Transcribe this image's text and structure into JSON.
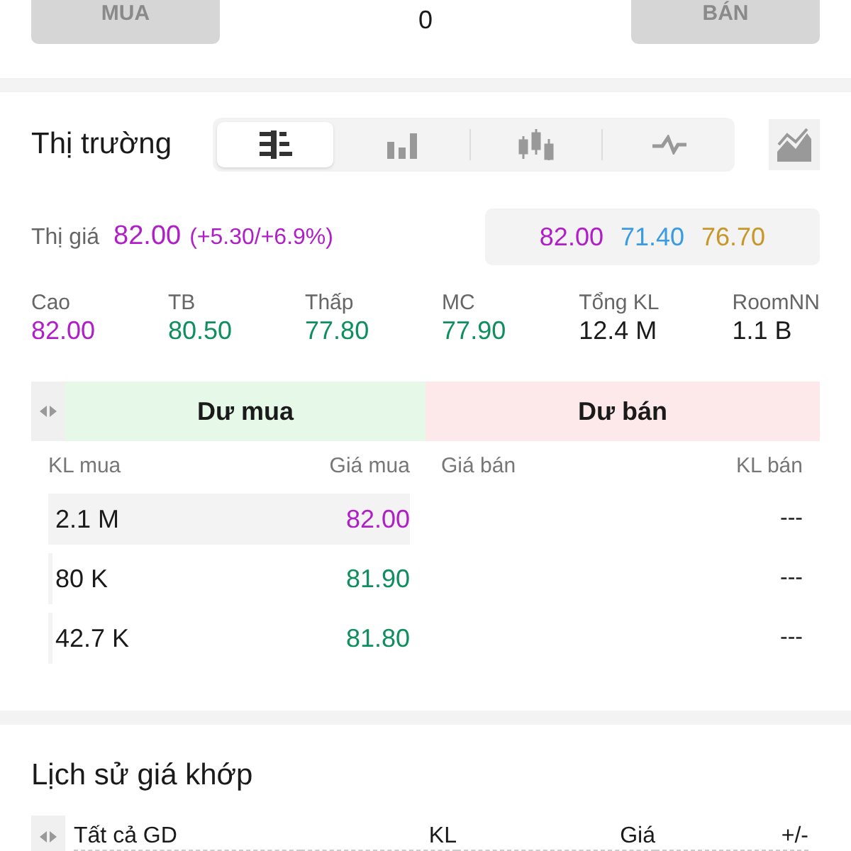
{
  "order_bar": {
    "buy_label": "MUA",
    "quantity": "0",
    "sell_label": "BÁN"
  },
  "market": {
    "title": "Thị trường",
    "view_tabs": [
      {
        "kind": "depth",
        "selected": true
      },
      {
        "kind": "bars",
        "selected": false
      },
      {
        "kind": "candles",
        "selected": false
      },
      {
        "kind": "line",
        "selected": false
      }
    ],
    "price_label": "Thị giá",
    "price": "82.00",
    "change": "(+5.30/+6.9%)",
    "ref_prices": [
      {
        "value": "82.00",
        "color": "#b01ec8"
      },
      {
        "value": "71.40",
        "color": "#3a9be2"
      },
      {
        "value": "76.70",
        "color": "#c8972a"
      }
    ],
    "stats": [
      {
        "label": "Cao",
        "value": "82.00",
        "color": "#b01ec8"
      },
      {
        "label": "TB",
        "value": "80.50",
        "color": "#0f8f60"
      },
      {
        "label": "Thấp",
        "value": "77.80",
        "color": "#0f8f60"
      },
      {
        "label": "MC",
        "value": "77.90",
        "color": "#0f8f60"
      },
      {
        "label": "Tổng KL",
        "value": "12.4 M",
        "color": "#1a1a1a"
      },
      {
        "label": "RoomNN",
        "value": "1.1 B",
        "color": "#1a1a1a"
      }
    ],
    "book": {
      "buy_header": "Dư mua",
      "sell_header": "Dư bán",
      "columns": [
        "KL mua",
        "Giá mua",
        "Giá bán",
        "KL bán"
      ],
      "rows": [
        {
          "buy_volume": "2.1 M",
          "buy_price": "82.00",
          "color": "#b01ec8",
          "sell_volume": "---"
        },
        {
          "buy_volume": "80 K",
          "buy_price": "81.90",
          "color": "#0f8f60",
          "sell_volume": "---"
        },
        {
          "buy_volume": "42.7 K",
          "buy_price": "81.80",
          "color": "#0f8f60",
          "sell_volume": "---"
        }
      ]
    }
  },
  "history": {
    "title": "Lịch sử giá khớp",
    "columns": [
      "Tất cả GD",
      "KL",
      "Giá",
      "+/-"
    ]
  }
}
